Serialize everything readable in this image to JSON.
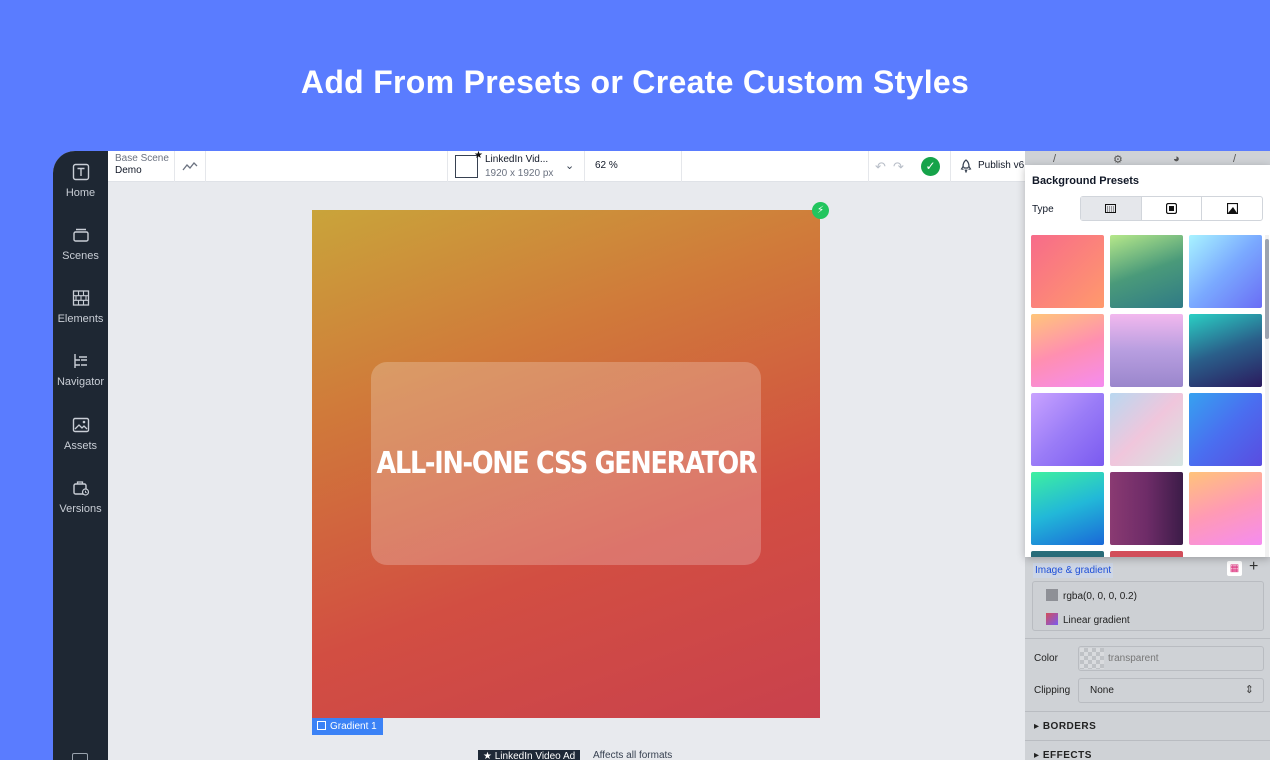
{
  "hero": {
    "title": "Add From Presets or Create Custom Styles"
  },
  "sidebar": {
    "items": [
      {
        "label": "Home",
        "icon": "text-box-icon"
      },
      {
        "label": "Scenes",
        "icon": "layers-icon"
      },
      {
        "label": "Elements",
        "icon": "grid-icon"
      },
      {
        "label": "Navigator",
        "icon": "tree-icon"
      },
      {
        "label": "Assets",
        "icon": "image-icon"
      },
      {
        "label": "Versions",
        "icon": "versions-icon"
      }
    ]
  },
  "topbar": {
    "scene_label": "Base Scene",
    "scene_name": "Demo",
    "format_name": "LinkedIn Vid...",
    "format_size": "1920 x 1920 px",
    "zoom": "62 %",
    "publish_label": "Publish v6"
  },
  "canvas": {
    "headline": "ALL-IN-ONE CSS GENERATOR",
    "layer_tag": "Gradient 1",
    "format_tag": "LinkedIn Video Ad",
    "affects_note": "Affects all formats"
  },
  "presets": {
    "title": "Background Presets",
    "type_label": "Type",
    "swatches": [
      "linear-gradient(135deg,#f76b8a,#ff9a6c)",
      "linear-gradient(160deg,#b6e88a,#4a9a7a,#2f7a86)",
      "linear-gradient(135deg,#a8f3ff,#7aa9ff,#6a6df5)",
      "linear-gradient(160deg,#ffc57a,#ff8fb0,#f58cf0)",
      "linear-gradient(180deg,#f2b8ee,#b89ee0,#9a86cc)",
      "linear-gradient(160deg,#2ad0c4,#2a5f8a,#2b1a5e)",
      "linear-gradient(135deg,#c9a3ff,#9a7cf7,#7a5af0)",
      "linear-gradient(135deg,#b9d8f0,#f0c6dc,#d5e6e2)",
      "linear-gradient(135deg,#36a2f0,#4a6ef0,#5a4ce0)",
      "linear-gradient(160deg,#3ef0a0,#22b8d8,#1a68d8)",
      "linear-gradient(90deg,#8a3a72,#6e2c68,#3c1c48)",
      "linear-gradient(160deg,#ffc37a,#ff9ab4,#f58cf0)",
      "linear-gradient(180deg,#2a6e7a,#1a3e5a)",
      "linear-gradient(180deg,#d24e5a,#c84a52)"
    ]
  },
  "panel": {
    "section_title": "Image & gradient",
    "layers": [
      {
        "label": "rgba(0, 0, 0, 0.2)",
        "swatch": "#8e9096"
      },
      {
        "label": "Linear gradient",
        "swatch": "linear-gradient(135deg,#d24e5a,#7a5af0)"
      }
    ],
    "color_label": "Color",
    "color_value": "transparent",
    "clipping_label": "Clipping",
    "clipping_value": "None",
    "borders_label": "BORDERS",
    "effects_label": "EFFECTS"
  }
}
